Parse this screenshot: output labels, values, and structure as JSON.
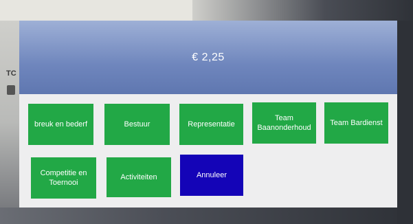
{
  "dialog": {
    "amount": "€ 2,25"
  },
  "buttons": [
    {
      "label": "breuk en bederf",
      "color": "#22a846"
    },
    {
      "label": "Bestuur",
      "color": "#22a846"
    },
    {
      "label": "Representatie",
      "color": "#22a846"
    },
    {
      "label": "Team Baanonderhoud",
      "color": "#22a846"
    },
    {
      "label": "Team Bardienst",
      "color": "#22a846"
    },
    {
      "label": "Competitie en Toernooi",
      "color": "#22a846"
    },
    {
      "label": "Activiteiten",
      "color": "#22a846"
    },
    {
      "label": "Annuleer",
      "color": "#1404b7"
    }
  ],
  "background": {
    "left_heading": "TC"
  }
}
